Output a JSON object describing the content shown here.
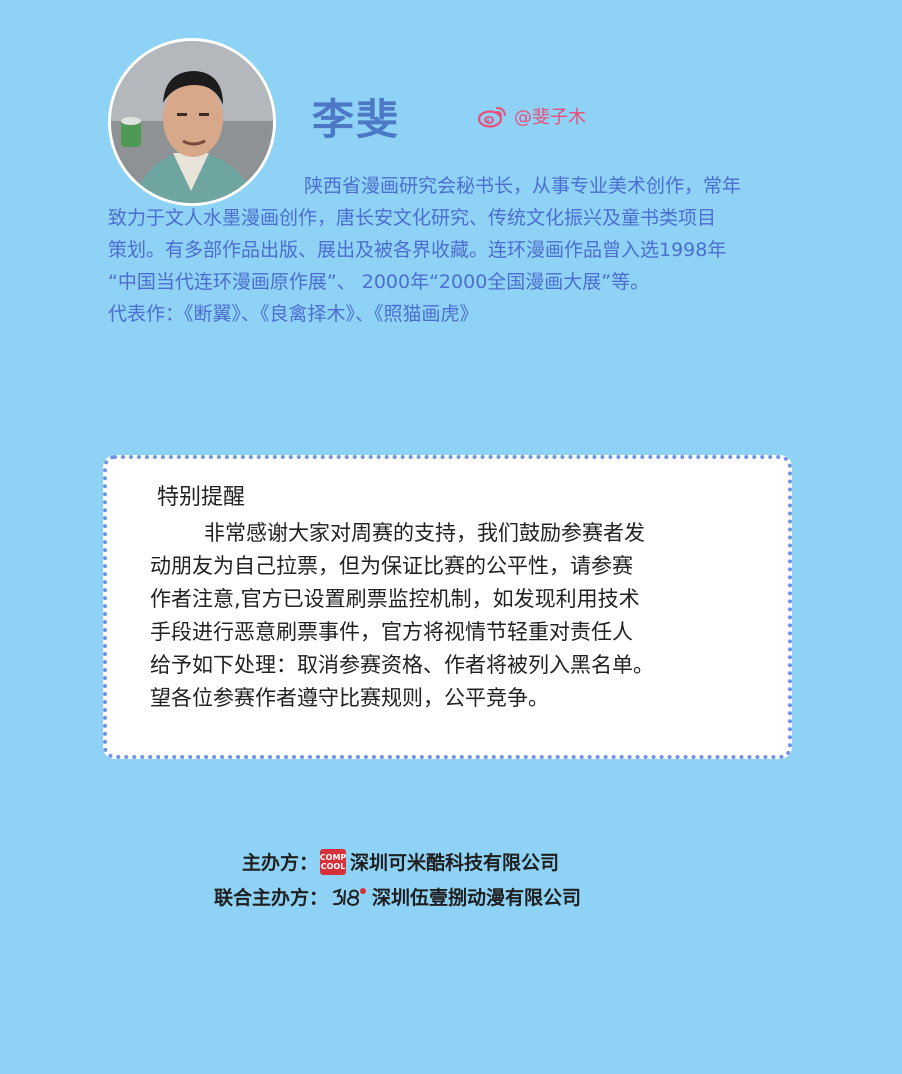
{
  "profile": {
    "name": "李斐",
    "weibo_handle": "@斐子木",
    "bio_lines": [
      "陕西省漫画研究会秘书长，从事专业美术创作，常年",
      "致力于文人水墨漫画创作，唐长安文化研究、传统文化振兴及童书类项目",
      "策划。有多部作品出版、展出及被各界收藏。连环漫画作品曾入选1998年",
      "“中国当代连环漫画原作展”、 2000年“2000全国漫画大展”等。",
      "代表作：《断翼》、《良禽择木》、《照猫画虎》"
    ]
  },
  "notice": {
    "title": "特别提醒",
    "lines": [
      "非常感谢大家对周赛的支持，我们鼓励参赛者发",
      "动朋友为自己拉票，但为保证比赛的公平性，请参赛",
      "作者注意,官方已设置刷票监控机制，如发现利用技术",
      "手段进行恶意刷票事件，官方将视情节轻重对责任人",
      "给予如下处理：取消参赛资格、作者将被列入黑名单。",
      "望各位参赛作者遵守比赛规则，公平竞争。"
    ]
  },
  "organizers": {
    "host_label": "主办方：",
    "host_logo_text_top": "COMP",
    "host_logo_text_bottom": "COOL",
    "host_name": "深圳可米酷科技有限公司",
    "co_host_label": "联合主办方：",
    "co_host_name": "深圳伍壹捌动漫有限公司"
  },
  "colors": {
    "background": "#8ed3f5",
    "accent_blue": "#4d6dd0",
    "weibo_red": "#e8507a"
  }
}
